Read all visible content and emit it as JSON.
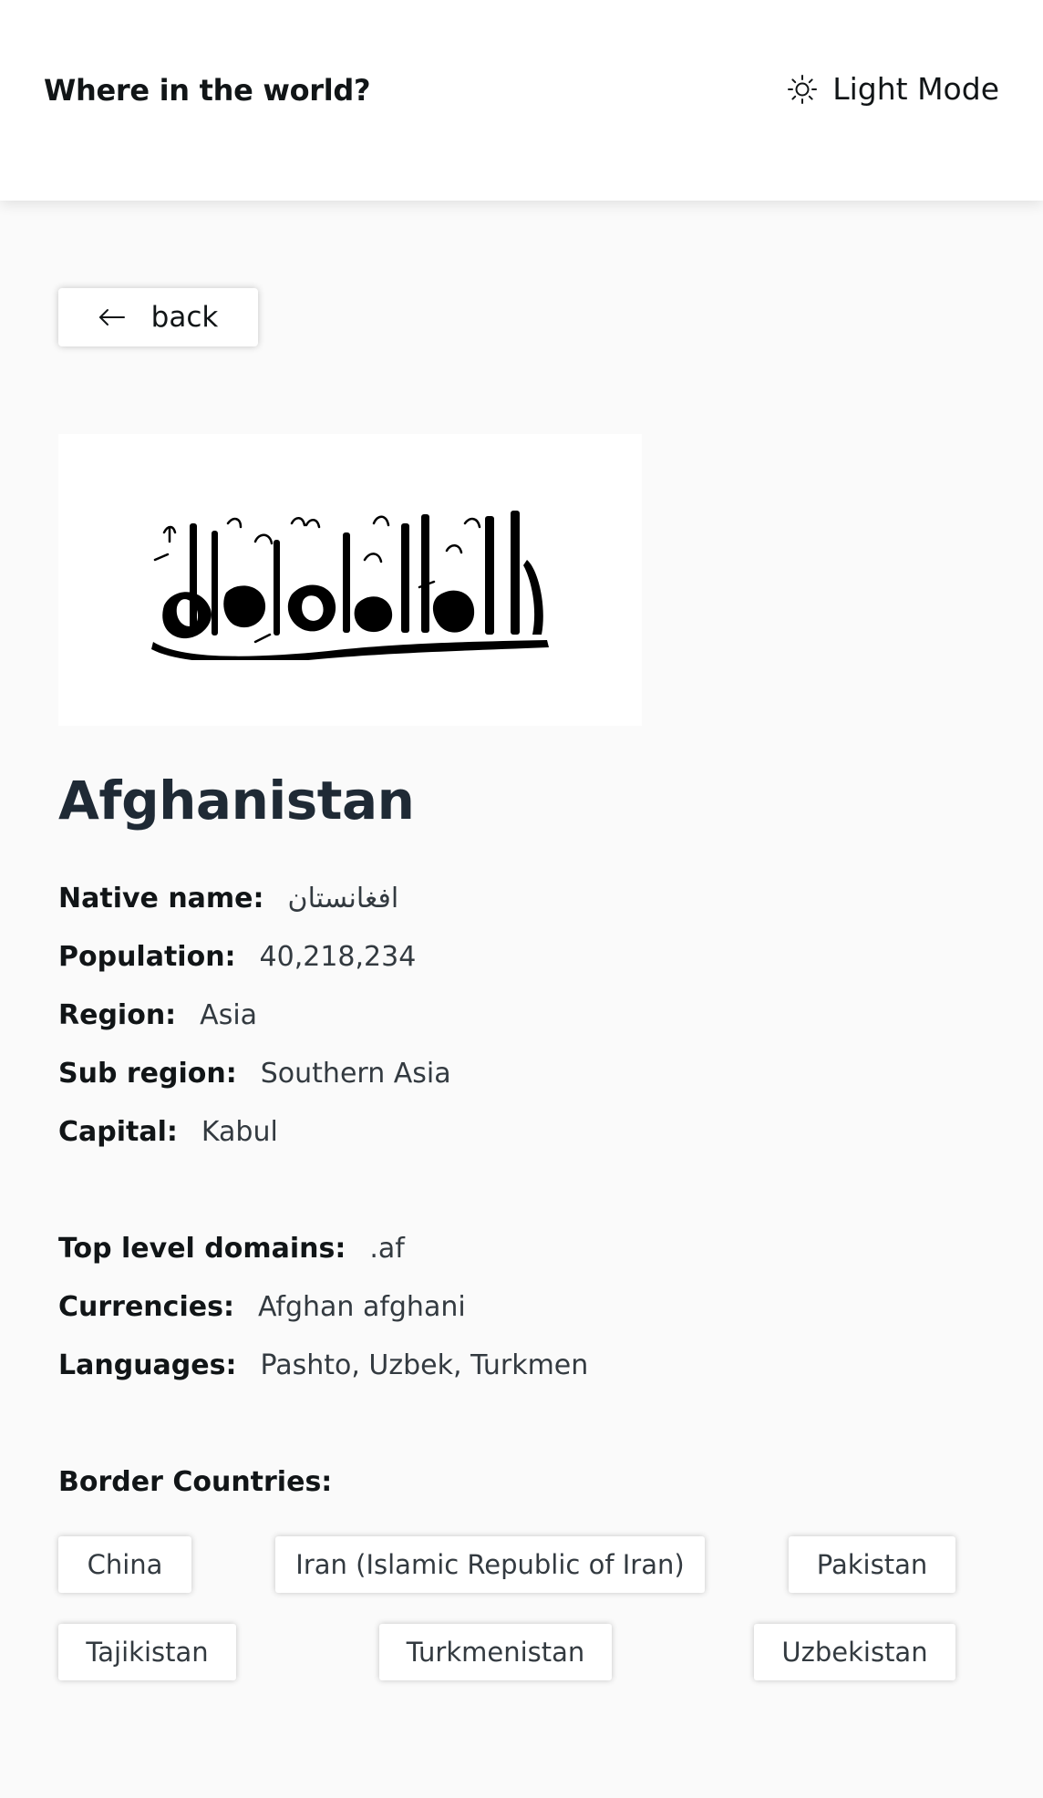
{
  "header": {
    "title": "Where in the world?",
    "theme_label": "Light Mode",
    "theme_icon": "sun-icon"
  },
  "back": {
    "label": "back",
    "icon": "arrow-left-icon"
  },
  "flag": {
    "icon": "flag-image",
    "background": "#ffffff"
  },
  "country": {
    "name": "Afghanistan",
    "details": [
      {
        "label": "Native name:",
        "value": "افغانستان"
      },
      {
        "label": "Population:",
        "value": "40,218,234"
      },
      {
        "label": "Region:",
        "value": "Asia"
      },
      {
        "label": "Sub region:",
        "value": "Southern Asia"
      },
      {
        "label": "Capital:",
        "value": "Kabul"
      },
      {
        "label": "Top level domains:",
        "value": ".af"
      },
      {
        "label": "Currencies:",
        "value": "Afghan afghani"
      },
      {
        "label": "Languages:",
        "value": "Pashto, Uzbek, Turkmen"
      }
    ]
  },
  "borders": {
    "title": "Border Countries:",
    "countries": [
      "China",
      "Iran (Islamic Republic of Iran)",
      "Pakistan",
      "Tajikistan",
      "Turkmenistan",
      "Uzbekistan"
    ]
  },
  "colors": {
    "background": "#fafafa",
    "element": "#ffffff",
    "text": "#111517"
  }
}
